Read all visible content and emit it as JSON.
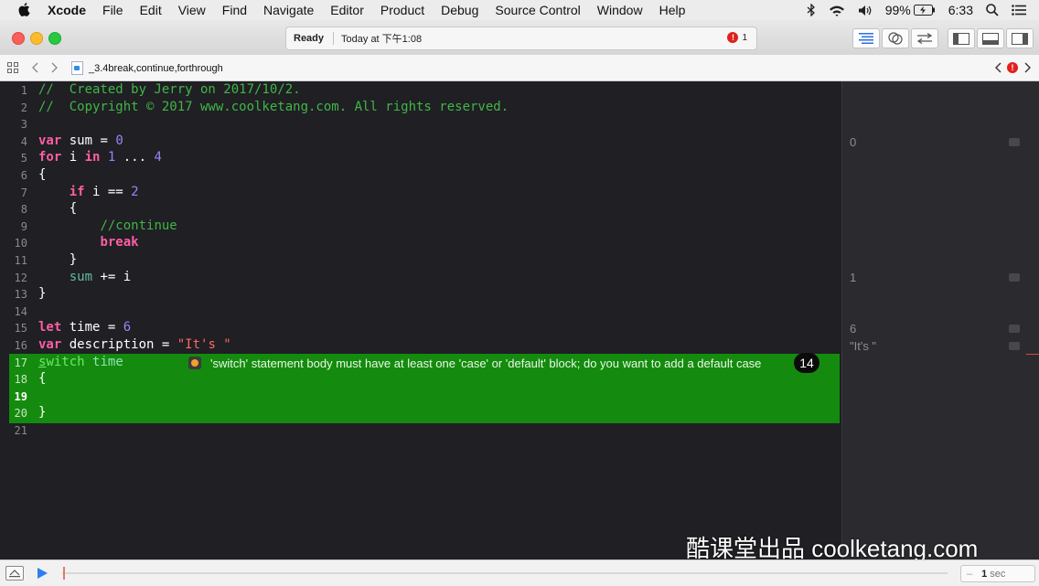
{
  "menubar": {
    "app": "Xcode",
    "items": [
      "File",
      "Edit",
      "View",
      "Find",
      "Navigate",
      "Editor",
      "Product",
      "Debug",
      "Source Control",
      "Window",
      "Help"
    ],
    "battery": "99%",
    "time": "6:33"
  },
  "toolbar": {
    "status": "Ready",
    "timestamp": "Today at 下午1:08",
    "error_count": "1"
  },
  "jumpbar": {
    "filename": "_3.4break,continue,forthrough"
  },
  "editor": {
    "line_numbers": [
      "1",
      "2",
      "3",
      "4",
      "5",
      "6",
      "7",
      "8",
      "9",
      "10",
      "11",
      "12",
      "13",
      "14",
      "15",
      "16",
      "17",
      "18",
      "19",
      "20",
      "21"
    ],
    "error_message": "'switch' statement body must have at least one 'case' or 'default' block; do you want to add a default case",
    "error_badge": "14"
  },
  "results": {
    "values": [
      "0",
      "1",
      "6",
      "\"It's \""
    ]
  },
  "bottombar": {
    "interval_value": "1",
    "interval_unit": "sec"
  },
  "watermark": "酷课堂出品 coolketang.com",
  "colors": {
    "comment": "#41b645",
    "keyword": "#fc5fa3",
    "number": "#9686f5",
    "string": "#fc6a5d",
    "error_highlight": "#148b0e"
  }
}
